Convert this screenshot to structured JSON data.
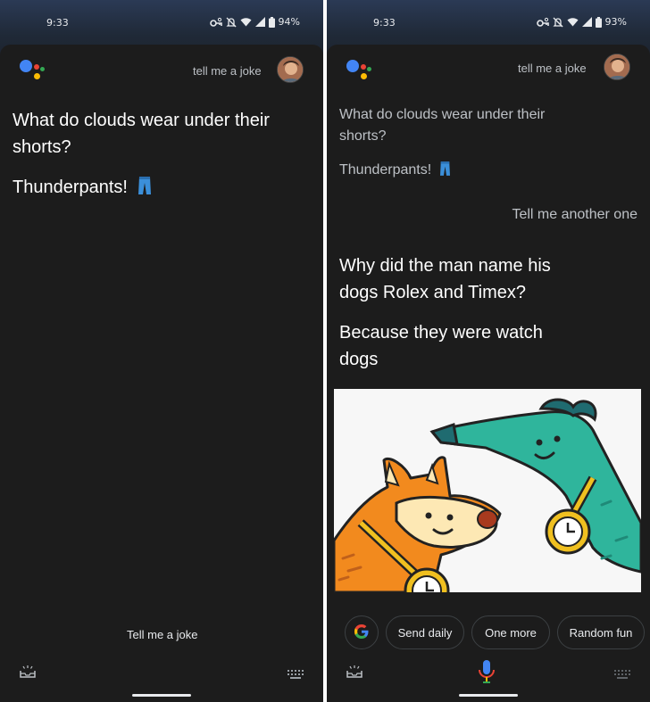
{
  "left": {
    "status": {
      "time": "9:33",
      "battery": "94%"
    },
    "query": "tell me a joke",
    "question": "What do clouds wear under their shorts?",
    "answer": "Thunderpants!",
    "answer_emoji": "jeans-emoji",
    "suggestion": "Tell me a joke"
  },
  "right": {
    "status": {
      "time": "9:33",
      "battery": "93%"
    },
    "query": "tell me a joke",
    "prev_question": "What do clouds wear under their shorts?",
    "prev_answer": "Thunderpants!",
    "followup": "Tell me another one",
    "question": "Why did the man name his dogs Rolex and Timex?",
    "answer": "Because they were watch dogs",
    "chips": [
      "Send daily",
      "One more",
      "Random fun"
    ]
  },
  "colors": {
    "google_blue": "#4285f4",
    "google_red": "#ea4335",
    "google_yellow": "#fbbc04",
    "google_green": "#34a853",
    "jeans": "#3b8fd9"
  }
}
